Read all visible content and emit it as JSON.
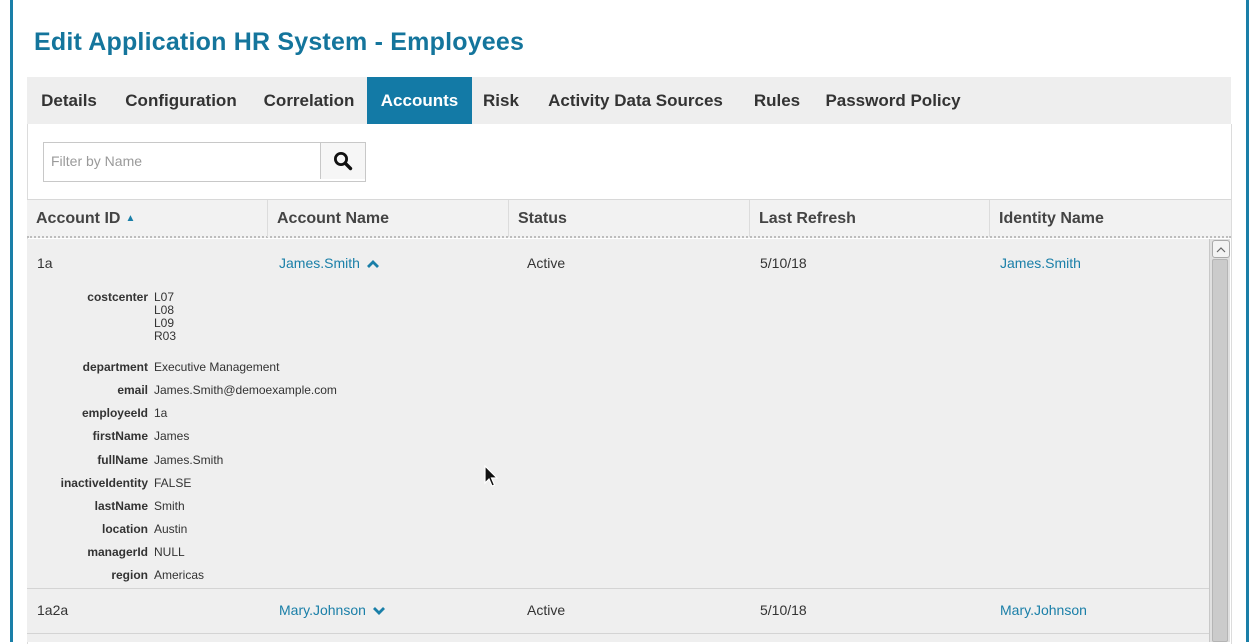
{
  "page": {
    "title": "Edit Application HR System - Employees"
  },
  "tabs": [
    {
      "label": "Details",
      "active": false
    },
    {
      "label": "Configuration",
      "active": false
    },
    {
      "label": "Correlation",
      "active": false
    },
    {
      "label": "Accounts",
      "active": true
    },
    {
      "label": "Risk",
      "active": false
    },
    {
      "label": "Activity Data Sources",
      "active": false
    },
    {
      "label": "Rules",
      "active": false
    },
    {
      "label": "Password Policy",
      "active": false
    }
  ],
  "filter": {
    "placeholder": "Filter by Name",
    "value": ""
  },
  "columns": [
    {
      "label": "Account ID",
      "sorted": "ascending",
      "sort_glyph": "▲"
    },
    {
      "label": "Account Name"
    },
    {
      "label": "Status"
    },
    {
      "label": "Last Refresh"
    },
    {
      "label": "Identity Name"
    }
  ],
  "rows": [
    {
      "account_id": "1a",
      "account_name": "James.Smith",
      "status": "Active",
      "last_refresh": "5/10/18",
      "identity_name": "James.Smith",
      "expanded": true,
      "attributes": [
        {
          "label": "costcenter",
          "values": [
            "L07",
            "L08",
            "L09",
            "R03"
          ]
        },
        {
          "label": "department",
          "values": [
            "Executive Management"
          ]
        },
        {
          "label": "email",
          "values": [
            "James.Smith@demoexample.com"
          ]
        },
        {
          "label": "employeeId",
          "values": [
            "1a"
          ]
        },
        {
          "label": "firstName",
          "values": [
            "James"
          ]
        },
        {
          "label": "fullName",
          "values": [
            "James.Smith"
          ]
        },
        {
          "label": "inactiveIdentity",
          "values": [
            "FALSE"
          ]
        },
        {
          "label": "lastName",
          "values": [
            "Smith"
          ]
        },
        {
          "label": "location",
          "values": [
            "Austin"
          ]
        },
        {
          "label": "managerId",
          "values": [
            "NULL"
          ]
        },
        {
          "label": "region",
          "values": [
            "Americas"
          ]
        }
      ]
    },
    {
      "account_id": "1a2a",
      "account_name": "Mary.Johnson",
      "status": "Active",
      "last_refresh": "5/10/18",
      "identity_name": "Mary.Johnson",
      "expanded": false
    }
  ],
  "colors": {
    "brand": "#14759c",
    "active_tab": "#137aa6",
    "link": "#1a7fa8"
  }
}
